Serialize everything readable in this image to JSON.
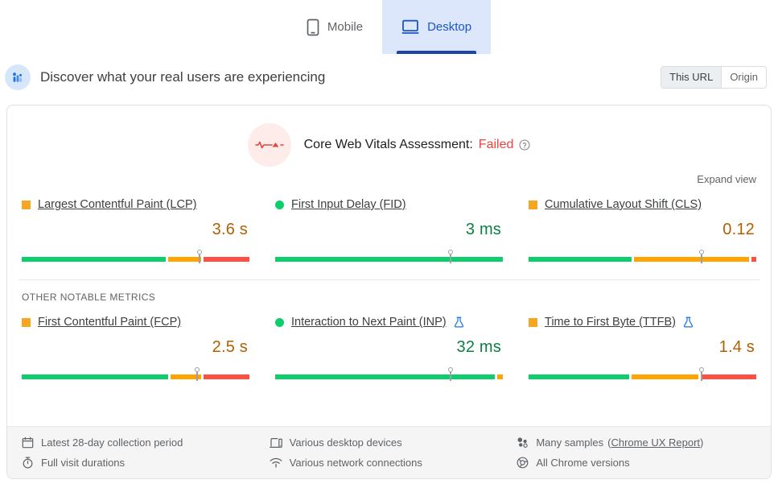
{
  "device_tabs": [
    {
      "label": "Mobile",
      "icon": "mobile-phone-icon",
      "active": false
    },
    {
      "label": "Desktop",
      "icon": "desktop-monitor-icon",
      "active": true
    }
  ],
  "discover": {
    "icon": "real-user-data-icon",
    "title": "Discover what your real users are experiencing",
    "scope": {
      "options": [
        "This URL",
        "Origin"
      ],
      "selected": "This URL"
    }
  },
  "assessment": {
    "icon": "pulse-line-icon",
    "label": "Core Web Vitals Assessment:",
    "status": "Failed",
    "status_color": "#e8453c",
    "help_icon": "help-circle-icon"
  },
  "expand_view_label": "Expand view",
  "section_label": "OTHER NOTABLE METRICS",
  "core_metrics": [
    {
      "name": "Largest Contentful Paint (LCP)",
      "short": "LCP",
      "marker": "square",
      "marker_color": "#f5a623",
      "rating": "avg",
      "value": "3.6 s",
      "experimental": false,
      "distribution": [
        {
          "color": "green",
          "percent": 64
        },
        {
          "color": "orange",
          "percent": 15
        },
        {
          "color": "red",
          "percent": 21
        }
      ],
      "pin_percent": 78
    },
    {
      "name": "First Input Delay (FID)",
      "short": "FID",
      "marker": "circle",
      "marker_color": "#0cce6b",
      "rating": "good",
      "value": "3 ms",
      "experimental": false,
      "distribution": [
        {
          "color": "green",
          "percent": 100
        }
      ],
      "pin_percent": 77
    },
    {
      "name": "Cumulative Layout Shift (CLS)",
      "short": "CLS",
      "marker": "square",
      "marker_color": "#f5a623",
      "rating": "avg",
      "value": "0.12",
      "experimental": false,
      "distribution": [
        {
          "color": "green",
          "percent": 46
        },
        {
          "color": "orange",
          "percent": 51
        },
        {
          "color": "red",
          "percent": 3
        }
      ],
      "pin_percent": 76
    }
  ],
  "other_metrics": [
    {
      "name": "First Contentful Paint (FCP)",
      "short": "FCP",
      "marker": "square",
      "marker_color": "#f5a623",
      "rating": "avg",
      "value": "2.5 s",
      "experimental": false,
      "distribution": [
        {
          "color": "green",
          "percent": 65
        },
        {
          "color": "orange",
          "percent": 14
        },
        {
          "color": "red",
          "percent": 21
        }
      ],
      "pin_percent": 77
    },
    {
      "name": "Interaction to Next Paint (INP)",
      "short": "INP",
      "marker": "circle",
      "marker_color": "#0cce6b",
      "rating": "good",
      "value": "32 ms",
      "experimental": true,
      "distribution": [
        {
          "color": "green",
          "percent": 97
        },
        {
          "color": "orange",
          "percent": 3
        }
      ],
      "pin_percent": 77
    },
    {
      "name": "Time to First Byte (TTFB)",
      "short": "TTFB",
      "marker": "square",
      "marker_color": "#f5a623",
      "rating": "avg",
      "value": "1.4 s",
      "experimental": true,
      "distribution": [
        {
          "color": "green",
          "percent": 45
        },
        {
          "color": "orange",
          "percent": 30
        },
        {
          "color": "red",
          "percent": 25
        }
      ],
      "pin_percent": 76
    }
  ],
  "footer": [
    {
      "icon": "calendar-icon",
      "text": "Latest 28-day collection period",
      "link": null
    },
    {
      "icon": "laptop-icon",
      "text": "Various desktop devices",
      "link": null
    },
    {
      "icon": "samples-icon",
      "text": "Many samples",
      "link": "Chrome UX Report"
    },
    {
      "icon": "stopwatch-icon",
      "text": "Full visit durations",
      "link": null
    },
    {
      "icon": "wifi-icon",
      "text": "Various network connections",
      "link": null
    },
    {
      "icon": "chrome-icon",
      "text": "All Chrome versions",
      "link": null
    }
  ]
}
